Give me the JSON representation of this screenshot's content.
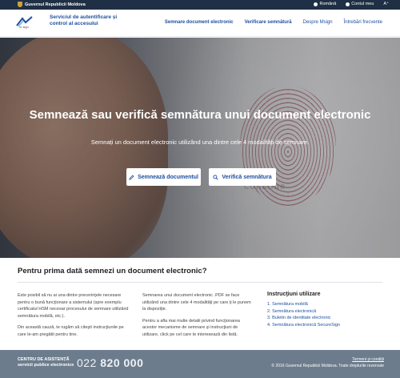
{
  "govbar": {
    "gov_name": "Guvernul Republicii Moldova",
    "language": "Română",
    "account": "Contul meu",
    "font_size": "A⁺"
  },
  "header": {
    "logo_text": "m.sign",
    "service_title": "Serviciul de autentificare și control al accesului",
    "nav": [
      {
        "label": "Semnare document electronic"
      },
      {
        "label": "Verificare semnătură"
      },
      {
        "label": "Despre Msign"
      },
      {
        "label": "Întrebări frecvente"
      }
    ]
  },
  "hero": {
    "title": "Semnează sau verifică semnătura unui document electronic",
    "subtitle": "Semnați un document electronic utilizând una dintre cele 4 modalități de semnare.",
    "sign_button": "Semnează documentul",
    "verify_button": "Verifică semnătura",
    "watermark": "conanue"
  },
  "intro": {
    "title": "Pentru prima dată semnezi un document electronic?",
    "col1": [
      "Este posibil să nu ai una dintre precerinţele necesare pentru o bună funcţionare a sistemului (spre exemplu certificatul HSM necesar procesului de semnare utilizând semnătura mobilă, etc.).",
      "Din această cauză, te rugăm să citeşti instrucţiunile pe care le-am pregătit pentru tine."
    ],
    "col2": [
      "Semnarea unui document electronic .PDF se face utilizând una dintre cele 4 modalităţi pe care ţi le punem la dispoziţie.",
      "Pentru a afla mai multe detalii privind funcţionarea acestor mecanisme de semnare şi instrucţiuni de utilizare, click pe cel care te interesează din listă."
    ],
    "instructions_title": "Instrucţiuni utilizare",
    "instructions": [
      "1. Semnătura mobilă",
      "2. Semnătura electronică",
      "3. Buletin de identitate electronic",
      "4. Semnătura electronică SecureSign"
    ]
  },
  "footer": {
    "support_line1": "CENTRU DE ASISTENȚĂ",
    "support_line2": "servicii publice electronice",
    "phone_prefix": "022",
    "phone_number": "820 000",
    "terms": "Termeni și condiții",
    "copyright": "© 2016 Guvernul Republicii Moldova. Toate drepturile rezervate"
  }
}
